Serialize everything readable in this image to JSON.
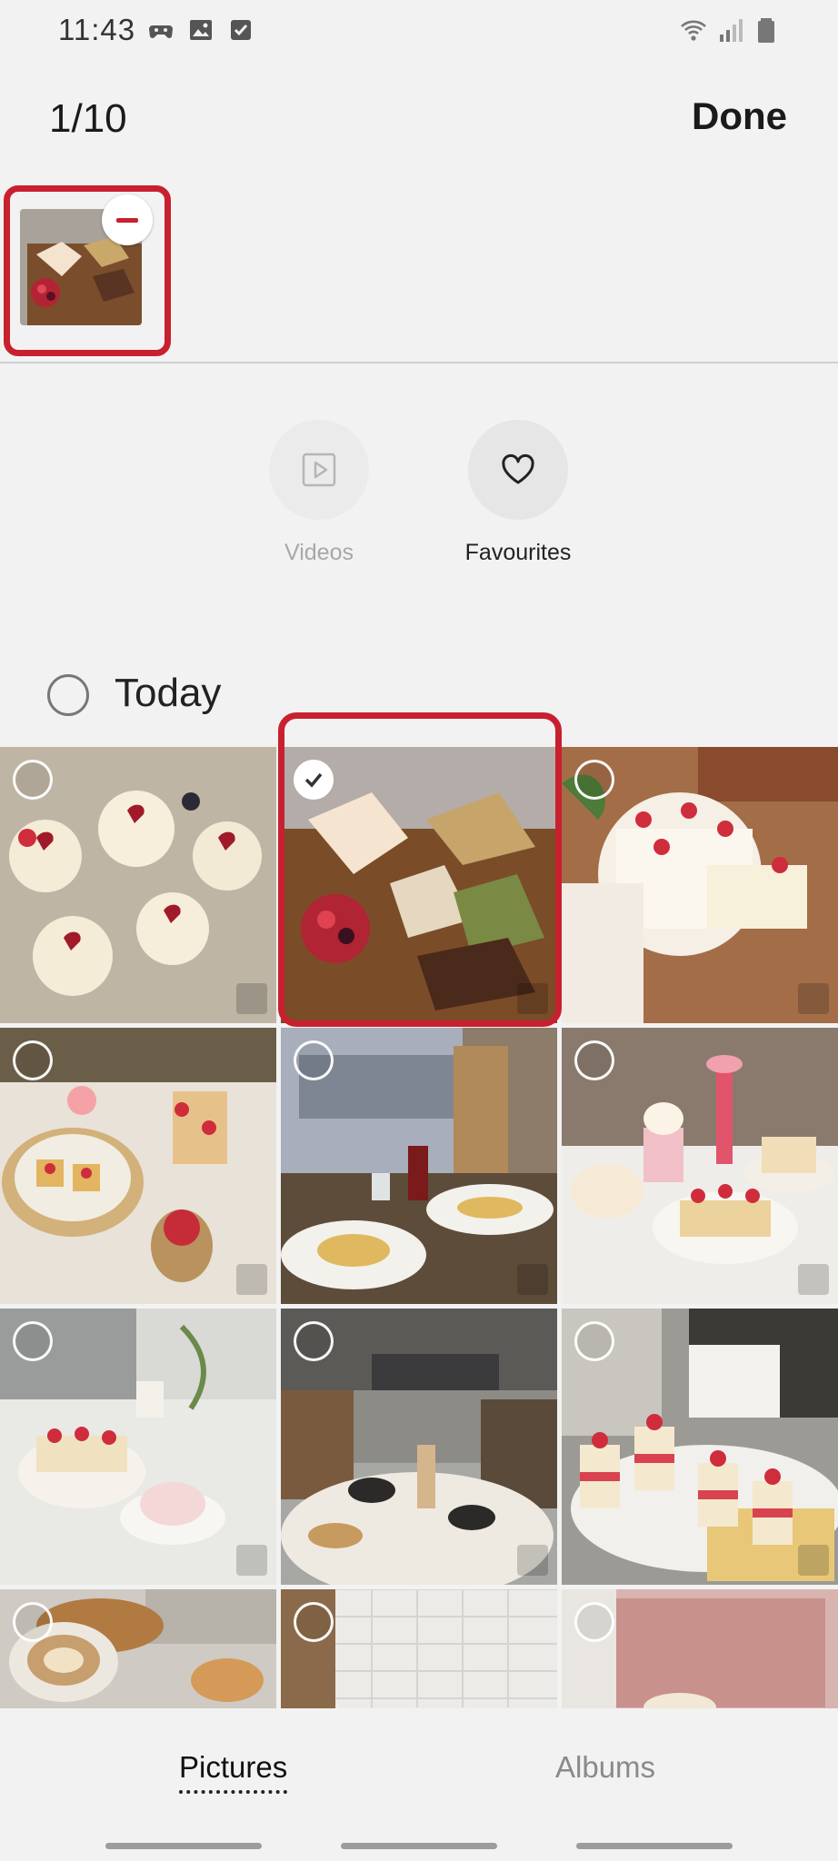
{
  "status_bar": {
    "time": "11:43",
    "left_icons": [
      "game-controller-icon",
      "image-icon",
      "checkbox-icon"
    ],
    "right_icons": [
      "wifi-icon",
      "signal-icon",
      "battery-icon"
    ]
  },
  "header": {
    "counter": "1/10",
    "done_label": "Done"
  },
  "selected_tray": {
    "items": [
      {
        "thumbnail": "cake-slices-on-board",
        "remove_icon": "minus-icon"
      }
    ]
  },
  "categories": [
    {
      "label": "Videos",
      "icon": "play-icon",
      "enabled": false
    },
    {
      "label": "Favourites",
      "icon": "heart-icon",
      "enabled": true
    }
  ],
  "section": {
    "label": "Today"
  },
  "grid": {
    "photos": [
      {
        "subject": "heart-cupcakes-in-box",
        "selected": false
      },
      {
        "subject": "cake-slices-on-board",
        "selected": true
      },
      {
        "subject": "strawberry-shortcake",
        "selected": false
      },
      {
        "subject": "strawberry-tarts-table",
        "selected": false
      },
      {
        "subject": "cafe-window-pasta",
        "selected": false
      },
      {
        "subject": "strawberry-desserts-drinks",
        "selected": false
      },
      {
        "subject": "cake-and-coffee-window",
        "selected": false
      },
      {
        "subject": "street-cafe-table",
        "selected": false
      },
      {
        "subject": "strawberry-cups-tray",
        "selected": false
      },
      {
        "subject": "coffee-croissants",
        "selected": false
      },
      {
        "subject": "white-tile-wall",
        "selected": false
      },
      {
        "subject": "pink-chair",
        "selected": false
      }
    ]
  },
  "bottom_nav": {
    "tabs": [
      {
        "label": "Pictures",
        "active": true
      },
      {
        "label": "Albums",
        "active": false
      }
    ]
  },
  "colors": {
    "highlight": "#c8202f",
    "background": "#f2f2f2"
  }
}
